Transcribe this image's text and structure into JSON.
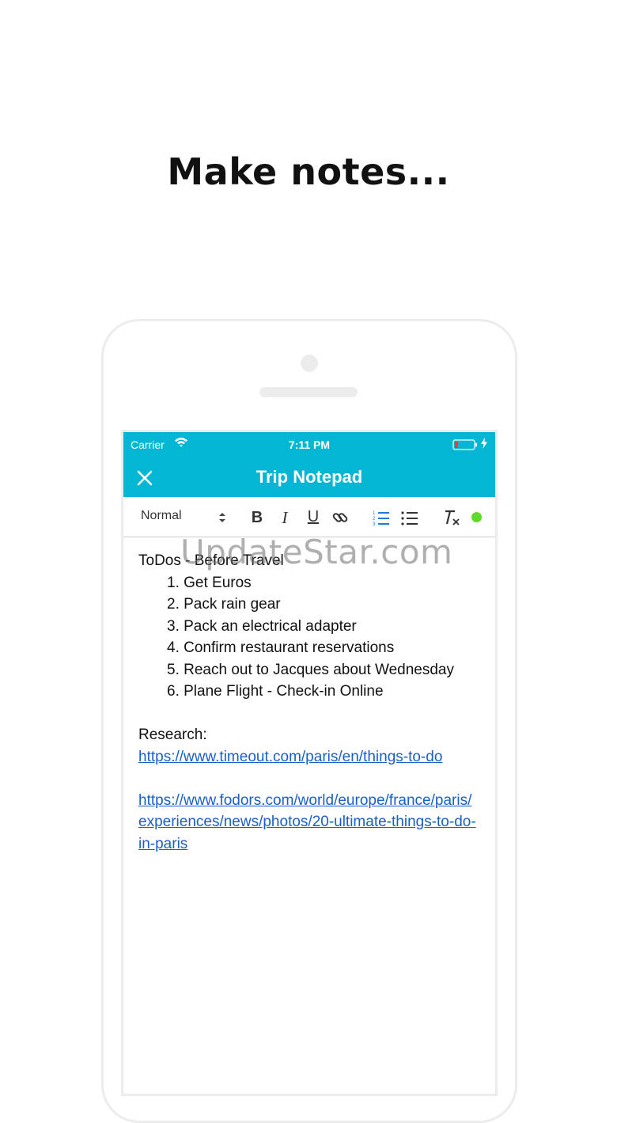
{
  "headline": "Make notes...",
  "status_bar": {
    "carrier": "Carrier",
    "time": "7:11 PM"
  },
  "nav": {
    "title": "Trip Notepad"
  },
  "toolbar": {
    "format_label": "Normal",
    "bold_label": "B",
    "italic_label": "I",
    "underline_label": "U"
  },
  "note": {
    "heading": "ToDos - Before Travel",
    "todos": [
      "1. Get Euros",
      "2. Pack rain gear",
      "3. Pack an electrical adapter",
      "4. Confirm restaurant reservations",
      "5. Reach out to Jacques about Wednesday",
      "6. Plane Flight - Check-in Online"
    ],
    "research_label": "Research:",
    "links": [
      "https://www.timeout.com/paris/en/things-to-do",
      "https://www.fodors.com/world/europe/france/paris/experiences/news/photos/20-ultimate-things-to-do-in-paris"
    ]
  },
  "watermark": "UpdateStar.com",
  "colors": {
    "accent": "#03b6d4",
    "link": "#1a5fc9",
    "status_dot": "#5ddb2b"
  }
}
